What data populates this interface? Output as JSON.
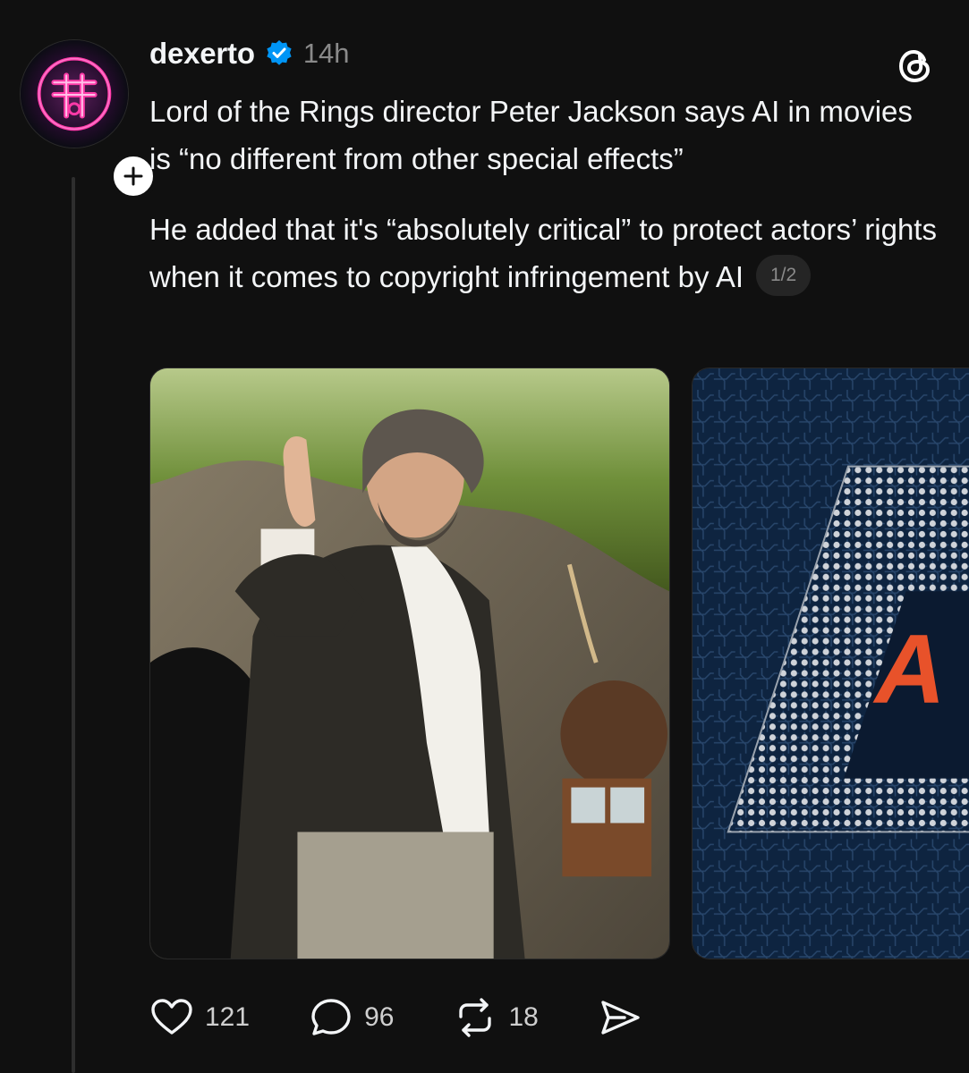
{
  "post": {
    "author": {
      "username": "dexerto",
      "verified": true,
      "avatar_icon": "dexerto-logo",
      "follow_icon": "plus-icon"
    },
    "timestamp": "14h",
    "app_logo_icon": "threads-icon",
    "paragraphs": [
      "Lord of the Rings director Peter Jackson says AI in movies is “no different from other special effects”",
      "He added that it's “absolutely critical” to protect actors’ rights when it comes to copyright infringement by AI"
    ],
    "page_indicator": "1/2",
    "media": [
      {
        "alt_icon": "photo-man-waving"
      },
      {
        "alt_icon": "ai-chip-image",
        "visible_text": "A"
      }
    ],
    "actions": {
      "like": {
        "icon": "heart-icon",
        "count": "121"
      },
      "reply": {
        "icon": "comment-icon",
        "count": "96"
      },
      "repost": {
        "icon": "repost-icon",
        "count": "18"
      },
      "share": {
        "icon": "send-icon"
      }
    }
  },
  "colors": {
    "background": "#101010",
    "text": "#f3f5f7",
    "muted": "#8a8a8a",
    "verified": "#0095f6",
    "thread_line": "#2e2e2e"
  }
}
